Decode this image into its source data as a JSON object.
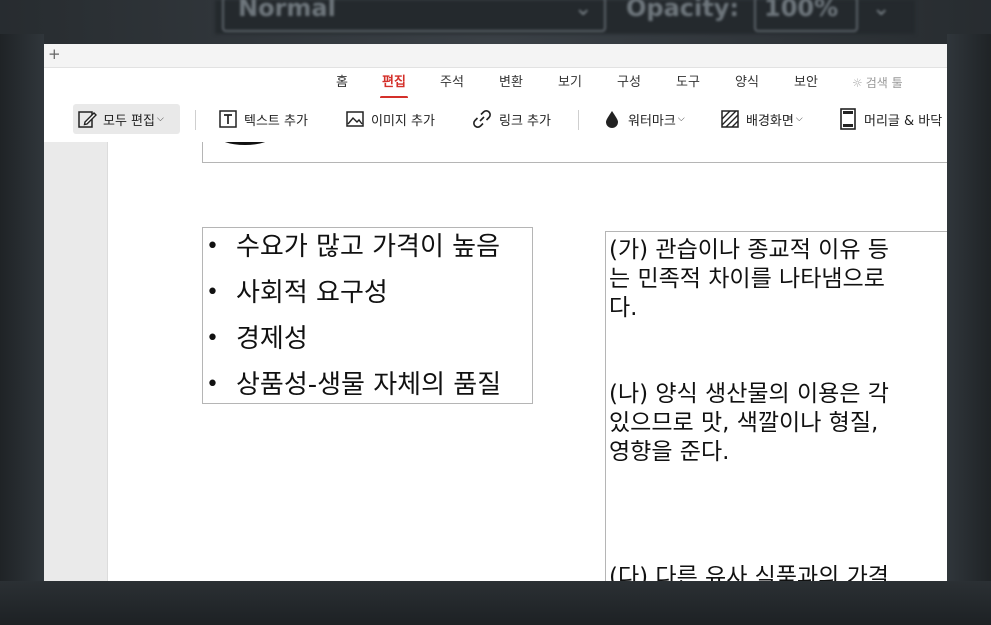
{
  "background_app": {
    "left_text": "Normal",
    "right_label": "Opacity:",
    "right_value": "100%"
  },
  "titlebar": {
    "new_tab_glyph": "+"
  },
  "menu": {
    "items": [
      {
        "label": "홈"
      },
      {
        "label": "편집"
      },
      {
        "label": "주석"
      },
      {
        "label": "변환"
      },
      {
        "label": "보기"
      },
      {
        "label": "구성"
      },
      {
        "label": "도구"
      },
      {
        "label": "양식"
      },
      {
        "label": "보안"
      }
    ],
    "active": "편집",
    "search_label": "검색 툴"
  },
  "toolbar": {
    "edit_all": "모두 편집",
    "add_text": "텍스트 추가",
    "add_image": "이미지 추가",
    "add_link": "링크 추가",
    "watermark": "워터마크",
    "background": "배경화면",
    "header_footer": "머리글 & 바닥"
  },
  "document": {
    "bullets": [
      "수요가 많고 가격이 높음",
      "사회적 요구성",
      "경제성",
      "상품성-생물 자체의 품질"
    ],
    "paragraph_lines": [
      "(가) 관습이나 종교적 이유 등",
      "는 민족적 차이를 나타냄으로",
      "다.",
      "(나) 양식 생산물의 이용은 각",
      "있으므로 맛, 색깔이나 형질,",
      "영향을 준다.",
      "(다) 다른 유사 식품과의 가격"
    ]
  },
  "colors": {
    "accent": "#d4302a",
    "toolbar_selected": "#e9e9e9",
    "left_pane": "#eaeaea"
  }
}
